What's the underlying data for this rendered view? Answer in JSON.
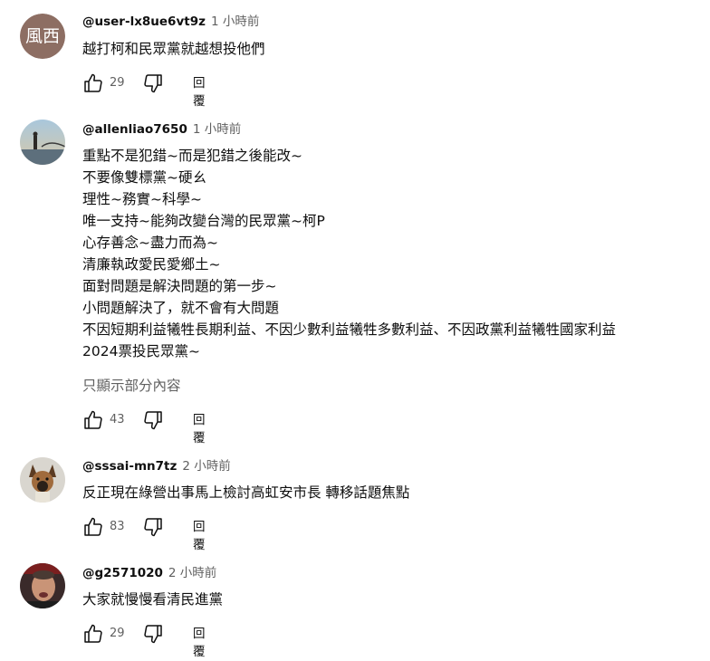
{
  "comments": [
    {
      "author": "@user-lx8ue6vt9z",
      "time": "1 小時前",
      "avatar_text": "風西",
      "lines": [
        "越打柯和民眾黨就越想投他們"
      ],
      "likes": "29",
      "reply_label": "回覆"
    },
    {
      "author": "@allenliao7650",
      "time": "1 小時前",
      "lines": [
        "重點不是犯錯~而是犯錯之後能改~",
        "不要像雙標黨~硬ㄠ",
        "理性~務實~科學~",
        "唯一支持~能夠改變台灣的民眾黨~柯P",
        "心存善念~盡力而為~",
        "清廉執政愛民愛鄉土~",
        "面對問題是解決問題的第一步~",
        "小問題解決了，就不會有大問題",
        "不因短期利益犧牲長期利益、不因少數利益犧牲多數利益、不因政黨利益犧牲國家利益",
        "2024票投民眾黨~"
      ],
      "show_more": "只顯示部分內容",
      "likes": "43",
      "reply_label": "回覆"
    },
    {
      "author": "@sssai-mn7tz",
      "time": "2 小時前",
      "lines": [
        "反正現在綠營出事馬上檢討高虹安市長 轉移話題焦點"
      ],
      "likes": "83",
      "reply_label": "回覆"
    },
    {
      "author": "@g2571020",
      "time": "2 小時前",
      "lines": [
        "大家就慢慢看清民進黨"
      ],
      "likes": "29",
      "reply_label": "回覆"
    }
  ],
  "icons": {
    "like": "thumb-up-icon",
    "dislike": "thumb-down-icon"
  },
  "colors": {
    "text": "#0f0f0f",
    "secondary_text": "#606060",
    "avatar_bg": "#8d6e63"
  }
}
